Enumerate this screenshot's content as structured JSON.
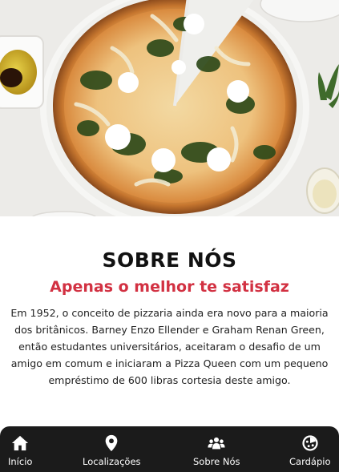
{
  "hero": {
    "image": "pizza-photo"
  },
  "about": {
    "title": "SOBRE NÓS",
    "subtitle": "Apenas o melhor te satisfaz",
    "paragraph": "Em 1952, o conceito de pizzaria ainda era novo para a maioria dos britânicos. Barney Enzo Ellender e Graham Renan Green, então estudantes universitários, aceitaram o desafio de um amigo em comum e iniciaram a Pizza Queen com um pequeno empréstimo de 600 libras cortesia deste amigo."
  },
  "nav": {
    "items": [
      {
        "label": "Início",
        "icon": "home-icon"
      },
      {
        "label": "Localizações",
        "icon": "map-pin-icon"
      },
      {
        "label": "Sobre Nós",
        "icon": "users-icon"
      },
      {
        "label": "Cardápio",
        "icon": "pizza-icon"
      }
    ]
  },
  "colors": {
    "accent": "#d23142",
    "nav_background": "#1b1b1b",
    "text": "#222222"
  }
}
